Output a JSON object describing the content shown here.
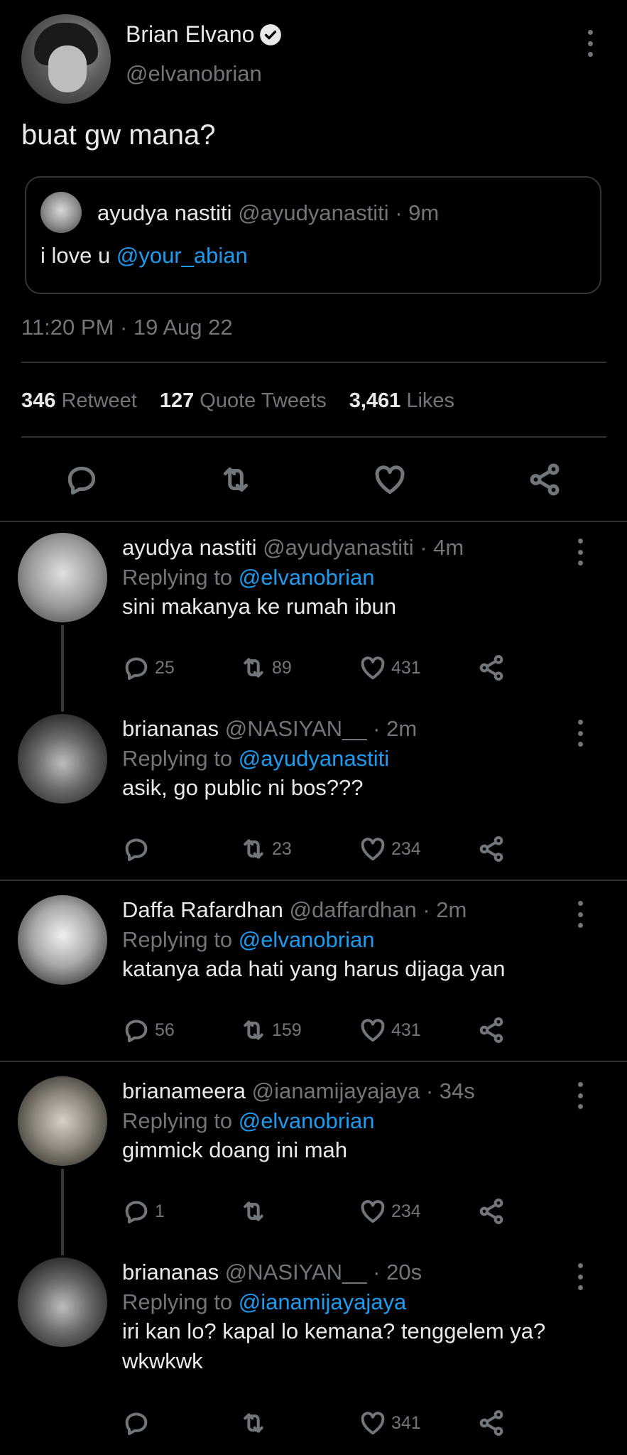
{
  "main_tweet": {
    "author_name": "Brian Elvano",
    "author_handle": "@elvanobrian",
    "text": "buat gw mana?",
    "quote": {
      "name": "ayudya nastiti",
      "handle": "@ayudyanastiti",
      "time": "· 9m",
      "text_prefix": "i love u",
      "mention": "@your_abian"
    },
    "timestamp": "11:20 PM · 19 Aug 22",
    "stats": {
      "retweets_count": "346",
      "retweets_label": "Retweet",
      "quotes_count": "127",
      "quotes_label": "Quote Tweets",
      "likes_count": "3,461",
      "likes_label": "Likes"
    }
  },
  "replies": [
    {
      "name": "ayudya nastiti",
      "handle": "@ayudyanastiti",
      "time": "· 4m",
      "replying_label": "Replying to",
      "replying_to": "@elvanobrian",
      "text": "sini makanya ke rumah ibun",
      "reply_count": "25",
      "retweet_count": "89",
      "like_count": "431"
    },
    {
      "name": "briananas",
      "handle": "@NASIYAN__",
      "time": "· 2m",
      "replying_label": "Replying to",
      "replying_to": "@ayudyanastiti",
      "text": "asik, go public ni bos???",
      "reply_count": "",
      "retweet_count": "23",
      "like_count": "234"
    },
    {
      "name": "Daffa Rafardhan",
      "handle": "@daffardhan",
      "time": "· 2m",
      "replying_label": "Replying to",
      "replying_to": "@elvanobrian",
      "text": "katanya ada hati yang harus dijaga yan",
      "reply_count": "56",
      "retweet_count": "159",
      "like_count": "431"
    },
    {
      "name": "brianameera",
      "handle": "@ianamijayajaya",
      "time": "· 34s",
      "replying_label": "Replying to",
      "replying_to": "@elvanobrian",
      "text": "gimmick doang ini mah",
      "reply_count": "1",
      "retweet_count": "",
      "like_count": "234"
    },
    {
      "name": "briananas",
      "handle": "@NASIYAN__",
      "time": "· 20s",
      "replying_label": "Replying to",
      "replying_to": "@ianamijayajaya",
      "text": "iri kan lo? kapal lo kemana? tenggelem ya? wkwkwk",
      "reply_count": "",
      "retweet_count": "",
      "like_count": "341"
    }
  ],
  "colors": {
    "background": "#000000",
    "text": "#e7e9ea",
    "muted": "#71767b",
    "link": "#1d9bf0",
    "divider": "#2f3336"
  },
  "icons": [
    "verified-badge-icon",
    "more-icon",
    "reply-icon",
    "retweet-icon",
    "like-icon",
    "share-icon"
  ]
}
